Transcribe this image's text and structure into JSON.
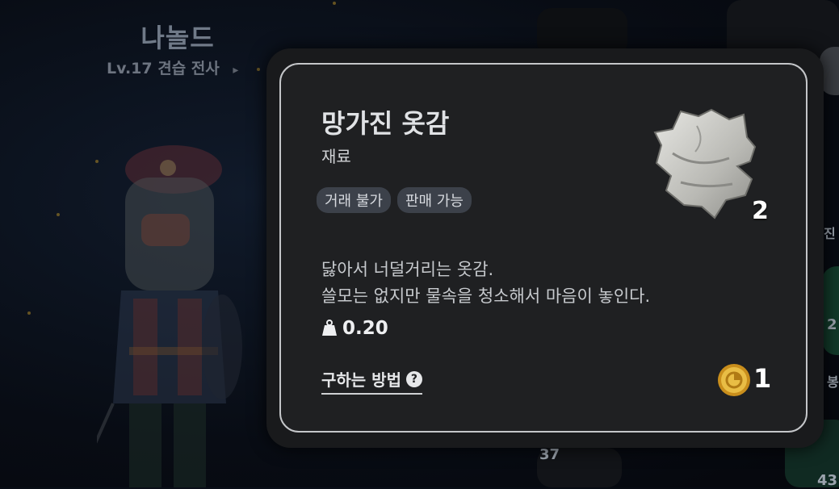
{
  "character": {
    "name": "나놀드",
    "level_label": "Lv.17",
    "class_name": "견습 전사",
    "arrow": "▸"
  },
  "background": {
    "slot_counts": [
      "37",
      "43"
    ],
    "edge_labels": [
      "진",
      "2",
      "봉"
    ]
  },
  "item": {
    "name": "망가진 옷감",
    "type": "재료",
    "tags": [
      "거래 불가",
      "판매 가능"
    ],
    "description_lines": [
      "닳아서 너덜거리는 옷감.",
      "쓸모는 없지만 물속을 청소해서 마음이 놓인다."
    ],
    "weight": "0.20",
    "quantity": "2",
    "how_to_get": "구하는 방법",
    "help_symbol": "?",
    "price": "1",
    "icon": "torn-cloth-icon",
    "coin_icon": "gold-coin-icon"
  },
  "colors": {
    "popup_bg": "#1f2022",
    "popup_border": "#c4c6c9",
    "tag_bg": "#3c414a",
    "coin_gold": "#e2b53a"
  }
}
